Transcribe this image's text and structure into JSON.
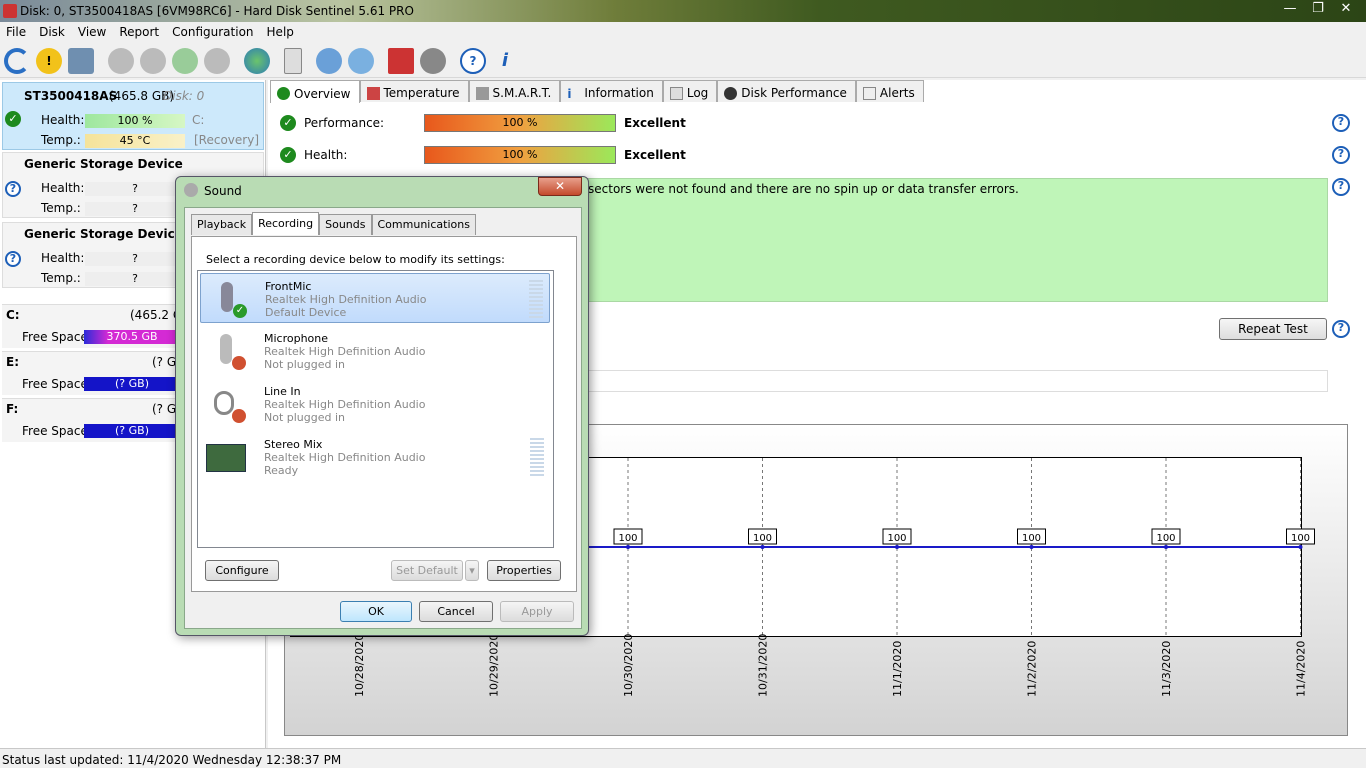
{
  "window": {
    "title": "Disk: 0, ST3500418AS [6VM98RC6]  -  Hard Disk Sentinel 5.61 PRO"
  },
  "menu": [
    "File",
    "Disk",
    "View",
    "Report",
    "Configuration",
    "Help"
  ],
  "toolbar_icons": [
    "refresh-icon",
    "warning-icon",
    "disk-icon",
    "hdd-icon",
    "hdd-icon",
    "hdd-icon",
    "hdd-icon",
    "globe-icon",
    "document-icon",
    "sync-icon",
    "network-icon",
    "chart-icon",
    "speaker-icon",
    "help-icon",
    "info-icon"
  ],
  "left": {
    "disk0": {
      "name": "ST3500418AS",
      "size": "(465.8 GB)",
      "index": "Disk: 0",
      "health_label": "Health:",
      "health": "100 %",
      "health_extra": "C:",
      "temp_label": "Temp.:",
      "temp": "45 °C",
      "temp_extra": "[Recovery]",
      "health_level": 1.0
    },
    "dev1": {
      "name": "Generic Storage Device",
      "health_label": "Health:",
      "health": "?",
      "temp_label": "Temp.:",
      "temp": "?"
    },
    "dev2": {
      "name": "Generic Storage Device",
      "health_label": "Health:",
      "health": "?",
      "temp_label": "Temp.:",
      "temp": "?"
    },
    "volumes": [
      {
        "letter": "C:",
        "size": "(465.2 GB",
        "free_label": "Free Space",
        "free": "370.5 GB"
      },
      {
        "letter": "E:",
        "size": "(? GB",
        "free_label": "Free Space",
        "free": "(? GB)"
      },
      {
        "letter": "F:",
        "size": "(? GB",
        "free_label": "Free Space",
        "free": "(? GB)"
      }
    ]
  },
  "tabs": [
    "Overview",
    "Temperature",
    "S.M.A.R.T.",
    "Information",
    "Log",
    "Disk Performance",
    "Alerts"
  ],
  "overview": {
    "perf_label": "Performance:",
    "perf_value": "100 %",
    "perf_rating": "Excellent",
    "health_label": "Health:",
    "health_value": "100 %",
    "health_rating": "Excellent",
    "message": "sectors were not found and there are no spin up or data transfer errors.",
    "repeat_test": "Repeat Test"
  },
  "chart_data": {
    "type": "line",
    "x": [
      "10/28/2020",
      "10/29/2020",
      "10/30/2020",
      "10/31/2020",
      "11/1/2020",
      "11/2/2020",
      "11/3/2020",
      "11/4/2020"
    ],
    "series": [
      {
        "values": [
          100,
          100,
          100,
          100,
          100,
          100,
          100,
          100
        ]
      }
    ],
    "labels_shown": [
      "100",
      "100",
      "100",
      "100",
      "100",
      "100"
    ],
    "ylim": [
      0,
      100
    ]
  },
  "status": "Status last updated: 11/4/2020 Wednesday 12:38:37 PM",
  "dialog": {
    "title": "Sound",
    "tabs": [
      "Playback",
      "Recording",
      "Sounds",
      "Communications"
    ],
    "instruction": "Select a recording device below to modify its settings:",
    "devices": [
      {
        "name": "FrontMic",
        "driver": "Realtek High Definition Audio",
        "status": "Default Device"
      },
      {
        "name": "Microphone",
        "driver": "Realtek High Definition Audio",
        "status": "Not plugged in"
      },
      {
        "name": "Line In",
        "driver": "Realtek High Definition Audio",
        "status": "Not plugged in"
      },
      {
        "name": "Stereo Mix",
        "driver": "Realtek High Definition Audio",
        "status": "Ready"
      }
    ],
    "configure": "Configure",
    "set_default": "Set Default",
    "properties": "Properties",
    "ok": "OK",
    "cancel": "Cancel",
    "apply": "Apply"
  }
}
